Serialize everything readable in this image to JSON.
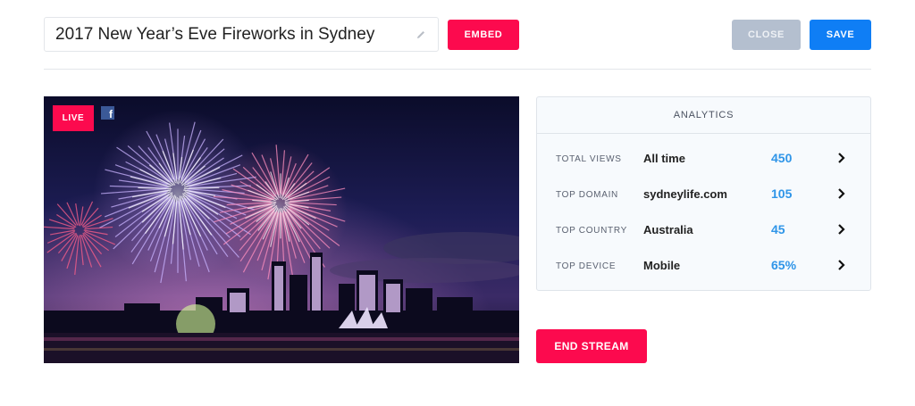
{
  "header": {
    "title_value": "2017 New Year’s Eve Fireworks in Sydney",
    "embed_label": "EMBED",
    "close_label": "CLOSE",
    "save_label": "SAVE"
  },
  "video": {
    "live_label": "LIVE",
    "facebook_glyph": "f"
  },
  "analytics": {
    "title": "ANALYTICS",
    "rows": [
      {
        "label": "TOTAL VIEWS",
        "value": "All time",
        "number": "450"
      },
      {
        "label": "TOP DOMAIN",
        "value": "sydneylife.com",
        "number": "105"
      },
      {
        "label": "TOP COUNTRY",
        "value": "Australia",
        "number": "45"
      },
      {
        "label": "TOP DEVICE",
        "value": "Mobile",
        "number": "65%"
      }
    ]
  },
  "actions": {
    "end_stream_label": "END STREAM"
  },
  "colors": {
    "accent_red": "#fc0a4e",
    "accent_blue": "#0f7ef5",
    "number_blue": "#2f95e8",
    "close_gray": "#b4bfcf"
  },
  "icons": [
    "pencil-icon",
    "facebook-icon",
    "chevron-right-icon"
  ]
}
